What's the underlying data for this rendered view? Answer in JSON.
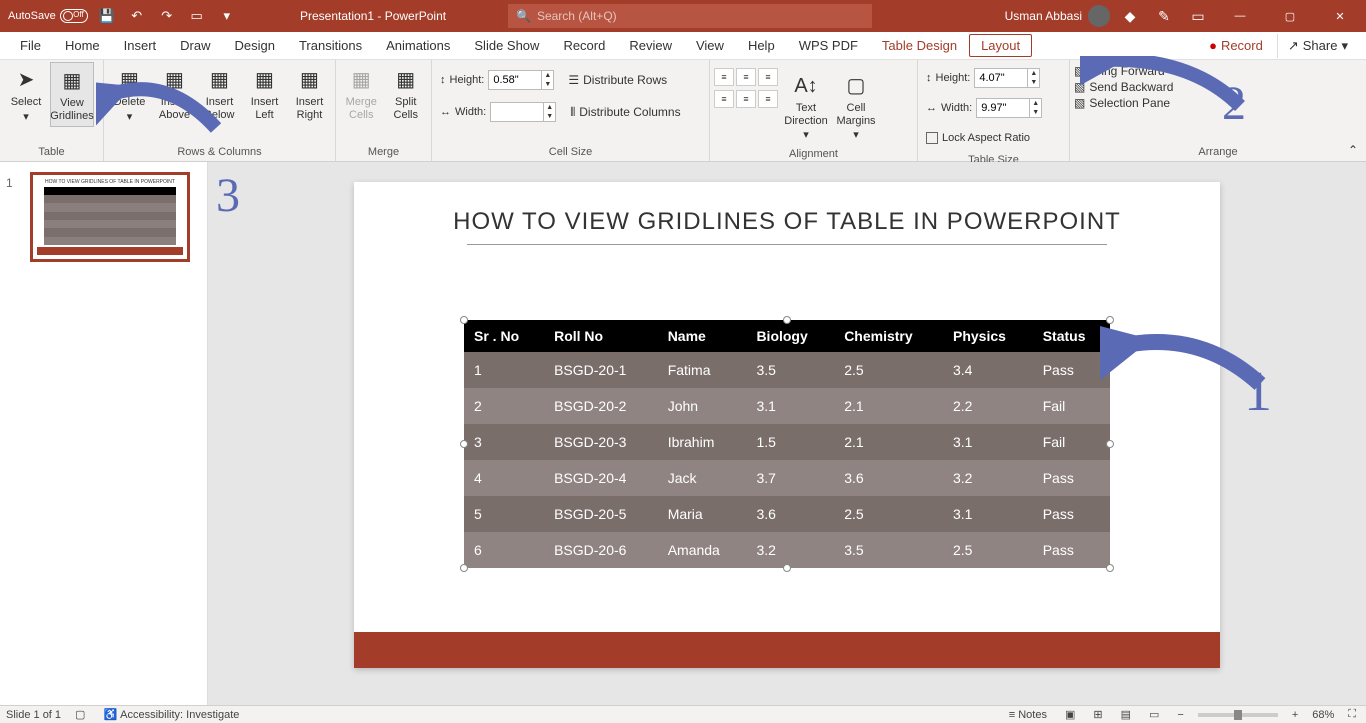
{
  "titlebar": {
    "autosave_label": "AutoSave",
    "autosave_state": "Off",
    "title": "Presentation1 - PowerPoint",
    "search_placeholder": "Search (Alt+Q)",
    "user_name": "Usman Abbasi"
  },
  "menu": {
    "tabs": [
      "File",
      "Home",
      "Insert",
      "Draw",
      "Design",
      "Transitions",
      "Animations",
      "Slide Show",
      "Record",
      "Review",
      "View",
      "Help",
      "WPS PDF"
    ],
    "context_tabs": [
      "Table Design",
      "Layout"
    ],
    "record": "Record",
    "share": "Share"
  },
  "ribbon": {
    "table": {
      "select": "Select",
      "view_gridlines": "View Gridlines",
      "label": "Table"
    },
    "rows_cols": {
      "delete": "Delete",
      "insert_above": "Insert Above",
      "insert_below": "Insert Below",
      "insert_left": "Insert Left",
      "insert_right": "Insert Right",
      "label": "Rows & Columns"
    },
    "merge": {
      "merge_cells": "Merge Cells",
      "split_cells": "Split Cells",
      "label": "Merge"
    },
    "cell_size": {
      "height_label": "Height:",
      "height_val": "0.58\"",
      "width_label": "Width:",
      "width_val": "",
      "dist_rows": "Distribute Rows",
      "dist_cols": "Distribute Columns",
      "label": "Cell Size"
    },
    "alignment": {
      "text_dir": "Text Direction",
      "cell_margins": "Cell Margins",
      "label": "Alignment"
    },
    "table_size": {
      "height_label": "Height:",
      "height_val": "4.07\"",
      "width_label": "Width:",
      "width_val": "9.97\"",
      "lock": "Lock Aspect Ratio",
      "label": "Table Size"
    },
    "arrange": {
      "bring_forward": "Bring Forward",
      "send_backward": "Send Backward",
      "selection_pane": "Selection Pane",
      "label": "Arrange"
    }
  },
  "slide": {
    "title": "HOW TO VIEW GRIDLINES OF TABLE IN POWERPOINT",
    "table": {
      "headers": [
        "Sr . No",
        "Roll No",
        "Name",
        "Biology",
        "Chemistry",
        "Physics",
        "Status"
      ],
      "rows": [
        [
          "1",
          "BSGD-20-1",
          "Fatima",
          "3.5",
          "2.5",
          "3.4",
          "Pass"
        ],
        [
          "2",
          "BSGD-20-2",
          "John",
          "3.1",
          "2.1",
          "2.2",
          "Fail"
        ],
        [
          "3",
          "BSGD-20-3",
          "Ibrahim",
          "1.5",
          "2.1",
          "3.1",
          "Fail"
        ],
        [
          "4",
          "BSGD-20-4",
          "Jack",
          "3.7",
          "3.6",
          "3.2",
          "Pass"
        ],
        [
          "5",
          "BSGD-20-5",
          "Maria",
          "3.6",
          "2.5",
          "3.1",
          "Pass"
        ],
        [
          "6",
          "BSGD-20-6",
          "Amanda",
          "3.2",
          "3.5",
          "2.5",
          "Pass"
        ]
      ]
    }
  },
  "annotations": {
    "n1": "1",
    "n2": "2",
    "n3": "3"
  },
  "statusbar": {
    "slide_info": "Slide 1 of 1",
    "accessibility": "Accessibility: Investigate",
    "notes": "Notes",
    "zoom": "68%"
  },
  "thumb": {
    "num": "1"
  }
}
